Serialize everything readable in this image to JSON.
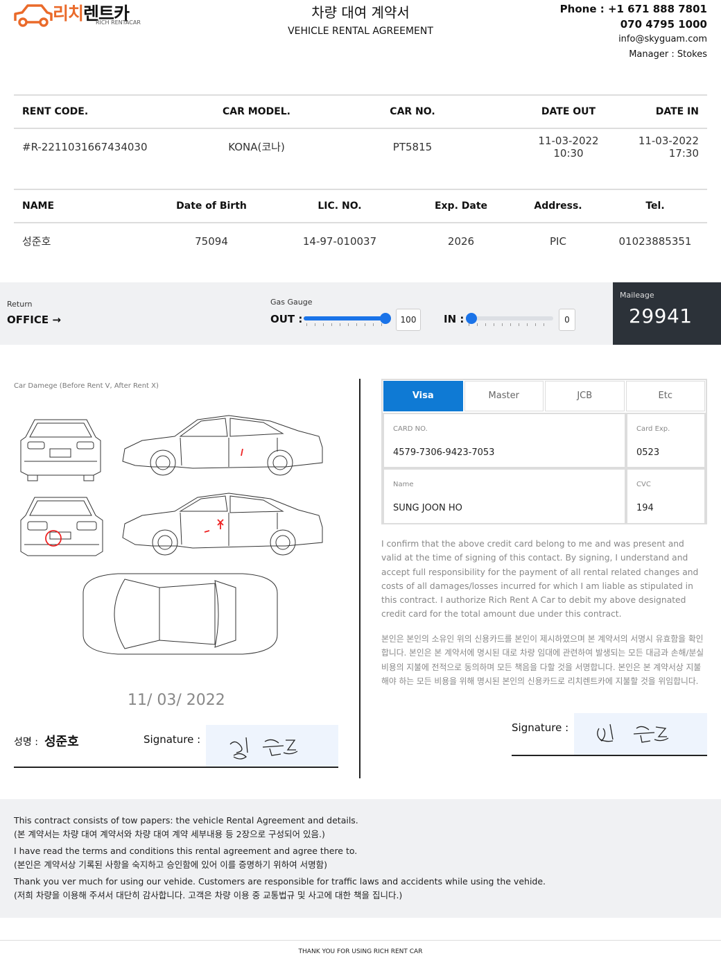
{
  "header": {
    "logo_kr_orange": "리치",
    "logo_kr_black": "렌트카",
    "logo_en": "RICH RENTACAR",
    "title_kr": "차량 대여 계약서",
    "title_en": "VEHICLE RENTAL AGREEMENT",
    "phone": "Phone : +1 671 888 7801",
    "phone2": "070 4795 1000",
    "email": "info@skyguam.com",
    "manager": "Manager : Stokes"
  },
  "rental": {
    "headers": [
      "RENT CODE.",
      "CAR MODEL.",
      "CAR NO.",
      "DATE OUT",
      "DATE IN"
    ],
    "row": [
      "#R-2211031667434030",
      "KONA(코나)",
      "PT5815",
      "11-03-2022 10:30",
      "11-03-2022 17:30"
    ]
  },
  "customer": {
    "headers": [
      "NAME",
      "Date of Birth",
      "LIC. NO.",
      "Exp. Date",
      "Address.",
      "Tel."
    ],
    "row": [
      "성준호",
      "75094",
      "14-97-010037",
      "2026",
      "PIC",
      "01023885351"
    ]
  },
  "gauge": {
    "return_label": "Return",
    "return_value": "OFFICE",
    "gas_label": "Gas Gauge",
    "out_label": "OUT :",
    "out_value": "100",
    "in_label": "IN :",
    "in_value": "0",
    "mileage_label": "Maileage",
    "mileage_value": "29941"
  },
  "damage": {
    "label": "Car Damege (Before Rent V, After Rent X)",
    "date": "11/ 03/ 2022",
    "name_label": "성명 :",
    "name_value": "성준호",
    "signature_label": "Signature :"
  },
  "card": {
    "tabs": [
      "Visa",
      "Master",
      "JCB",
      "Etc"
    ],
    "active_tab": "Visa",
    "card_no_label": "CARD NO.",
    "card_no": "4579-7306-9423-7053",
    "exp_label": "Card Exp.",
    "exp": "0523",
    "name_label": "Name",
    "name": "SUNG JOON HO",
    "cvc_label": "CVC",
    "cvc": "194",
    "terms_en": "I confirm that the above credit card belong to me and was present and valid at the time of signing of this contact. By signing, I understand and accept full responsibility for the payment of all rental related changes and costs of all damages/losses incurred for which I am liable as stipulated in this contract. I authorize Rich Rent A Car to debit my above designated credit card for the total amount due under this contract.",
    "terms_kr": "본인은 본인의 소유인 위의 신용카드를 본인이 제시하였으며 본 계약서의 서명시 유효함을 확인합니다. 본인은 본 계약서에 명시된 대로 차량 임대에 관련하여 발생되는 모든 대금과 손해/분실비용의 지불에 전적으로 동의하며 모든 책음을 다할 것을 서명합니다. 본인은 본 계약서상 지불해야 하는 모든 비용을 위해 명시된 본인의 신용카드로 리치렌트카에 지불할 것을 위임합니다.",
    "signature_label": "Signature :"
  },
  "footer": {
    "lines": [
      "This contract consists of tow papers: the vehicle Rental Agreement and details.",
      "(본 계약서는 차량 대여 계약서와 차량 대여 계약 세부내용 등 2장으로 구성되어 있음.)",
      "I have read the terms and conditions this rental agreement and agree there to.",
      "(본인은 계약서상 기록된 사항을 숙지하고 승인함에 있어 이를 증명하기 위하여 서명함)",
      "Thank you ver much for using our vehide. Customers are responsible for traffic laws and accidents while using the vehide.",
      "(저희 차량을 이용해 주셔서 대단히 감사합니다. 고객은 차량 이용 중 교통법규 및 사고에 대한 책을 집니다.)"
    ],
    "thanks": "THANK YOU FOR USING RICH RENT CAR"
  }
}
